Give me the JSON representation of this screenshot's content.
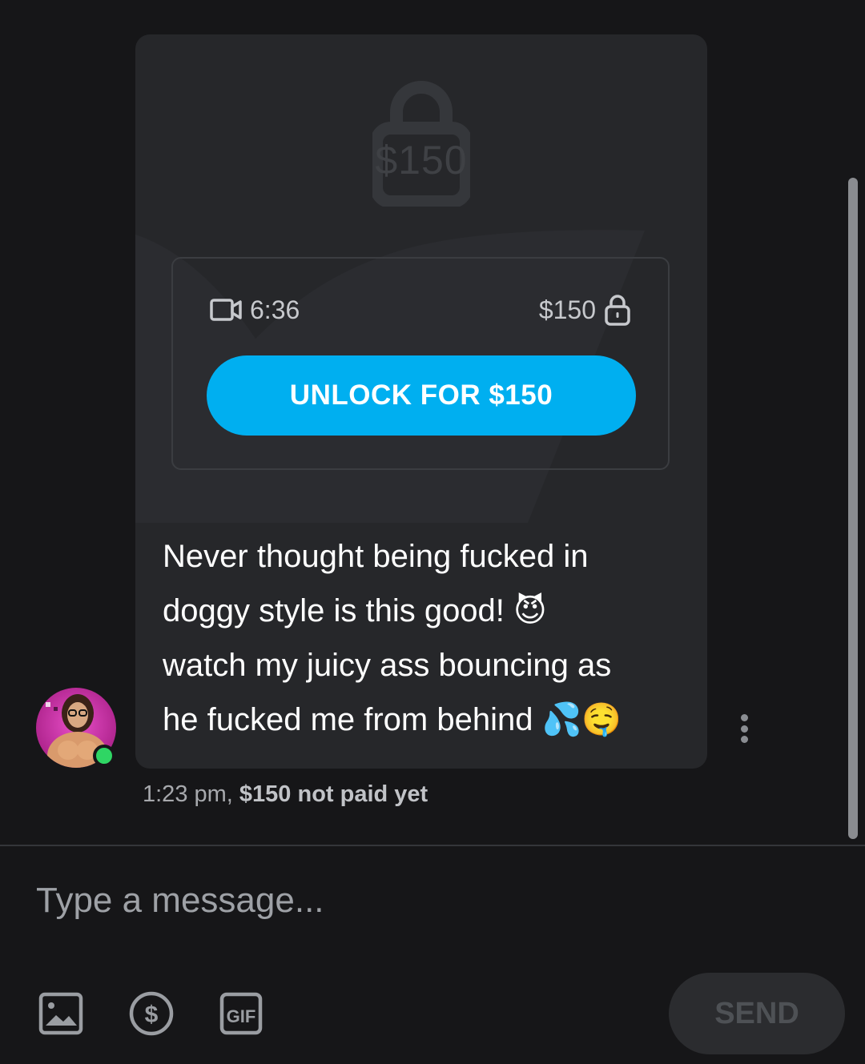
{
  "message": {
    "locked_price_overlay": "$150",
    "media": {
      "duration": "6:36",
      "price": "$150"
    },
    "unlock_button_label": "UNLOCK FOR $150",
    "text_lines": [
      "Never thought being fucked in",
      "doggy style is this good! 😈",
      "watch my juicy ass bouncing as",
      "he fucked me from behind 💦🤤"
    ],
    "time": "1:23 pm,",
    "payment_status": "$150 not paid yet"
  },
  "sender": {
    "online": true
  },
  "composer": {
    "placeholder": "Type a message...",
    "send_label": "SEND",
    "tools": [
      "image-icon",
      "dollar-icon",
      "gif-icon"
    ]
  },
  "colors": {
    "accent": "#00aff0",
    "background": "#161618",
    "card": "#26272a",
    "online": "#2fd664"
  }
}
